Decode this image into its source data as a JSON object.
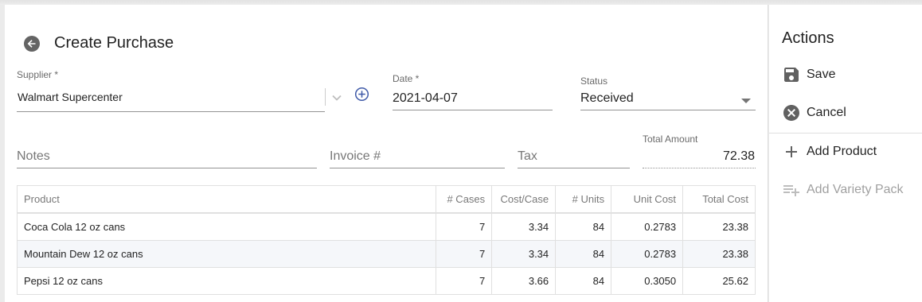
{
  "page": {
    "title": "Create Purchase"
  },
  "form": {
    "supplier": {
      "label": "Supplier *",
      "value": "Walmart Supercenter"
    },
    "date": {
      "label": "Date *",
      "value": "2021-04-07"
    },
    "status": {
      "label": "Status",
      "value": "Received"
    },
    "notes": {
      "placeholder": "Notes"
    },
    "invoice": {
      "placeholder": "Invoice #"
    },
    "tax": {
      "placeholder": "Tax"
    },
    "total_amount": {
      "label": "Total Amount",
      "value": "72.38"
    }
  },
  "table": {
    "headers": [
      "Product",
      "# Cases",
      "Cost/Case",
      "# Units",
      "Unit Cost",
      "Total Cost"
    ],
    "rows": [
      [
        "Coca Cola 12 oz cans",
        "7",
        "3.34",
        "84",
        "0.2783",
        "23.38"
      ],
      [
        "Mountain Dew 12 oz cans",
        "7",
        "3.34",
        "84",
        "0.2783",
        "23.38"
      ],
      [
        "Pepsi 12 oz cans",
        "7",
        "3.66",
        "84",
        "0.3050",
        "25.62"
      ]
    ]
  },
  "actions": {
    "title": "Actions",
    "save": "Save",
    "cancel": "Cancel",
    "add_product": "Add Product",
    "add_variety_pack": "Add Variety Pack"
  },
  "icons": {
    "back": "arrow-back-circle-icon",
    "add_supplier": "add-circle-outline-icon",
    "save": "floppy-disk-icon",
    "cancel": "cancel-circle-icon",
    "add": "plus-icon",
    "playlist_add": "playlist-add-icon"
  }
}
